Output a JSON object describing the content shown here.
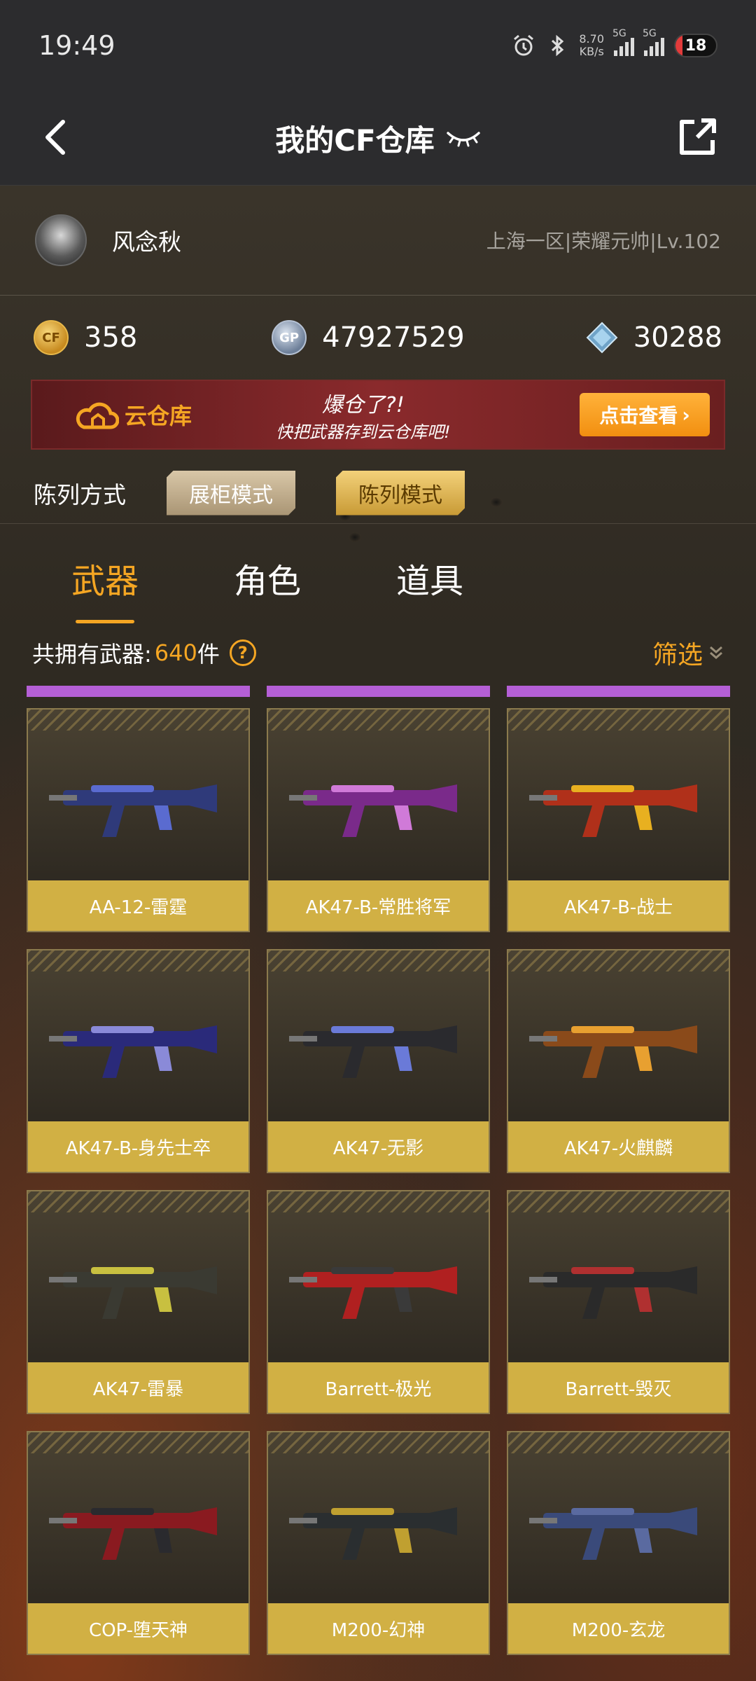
{
  "status_bar": {
    "time": "19:49",
    "net_speed_value": "8.70",
    "net_speed_unit": "KB/s",
    "sim1_label": "5G",
    "sim2_label": "5G",
    "battery": "18",
    "battery_level": 0.18
  },
  "nav": {
    "title": "我的CF仓库"
  },
  "profile": {
    "username": "风念秋",
    "server_info": "上海一区|荣耀元帅|Lv.102"
  },
  "currency": {
    "cf_points": "358",
    "gp": "47927529",
    "diamond": "30288",
    "gp_icon_text": "GP",
    "cf_icon_text": "CF"
  },
  "cloud_banner": {
    "title": "云仓库",
    "message_line1": "爆仓了?!",
    "message_line2": "快把武器存到云仓库吧!",
    "button_label": "点击查看",
    "button_arrow": "›"
  },
  "display_mode": {
    "label": "陈列方式",
    "options": [
      "展柜模式",
      "陈列模式"
    ],
    "selected": "陈列模式"
  },
  "tabs": [
    {
      "label": "武器",
      "active": true
    },
    {
      "label": "角色",
      "active": false
    },
    {
      "label": "道具",
      "active": false
    }
  ],
  "inventory": {
    "count_label": "共拥有武器:",
    "count": "640",
    "count_unit": "件",
    "help_glyph": "?",
    "filter_label": "筛选"
  },
  "items": [
    {
      "name": "AA-12-雷霆",
      "weapon_color": "#2f3a7a",
      "accent": "#5a6bd0"
    },
    {
      "name": "AK47-B-常胜将军",
      "weapon_color": "#7a2a8a",
      "accent": "#d07ad8"
    },
    {
      "name": "AK47-B-战士",
      "weapon_color": "#b0301a",
      "accent": "#e8b020"
    },
    {
      "name": "AK47-B-身先士卒",
      "weapon_color": "#2a2a7a",
      "accent": "#8a8ad8"
    },
    {
      "name": "AK47-无影",
      "weapon_color": "#2a2a2e",
      "accent": "#6a7ad8"
    },
    {
      "name": "AK47-火麒麟",
      "weapon_color": "#8a4a1a",
      "accent": "#e8a030"
    },
    {
      "name": "AK47-雷暴",
      "weapon_color": "#3a3a32",
      "accent": "#c8c040"
    },
    {
      "name": "Barrett-极光",
      "weapon_color": "#b02020",
      "accent": "#3a3a3a"
    },
    {
      "name": "Barrett-毁灭",
      "weapon_color": "#2a2a2a",
      "accent": "#b03030"
    },
    {
      "name": "COP-堕天神",
      "weapon_color": "#8a1a20",
      "accent": "#2a2a2e"
    },
    {
      "name": "M200-幻神",
      "weapon_color": "#2a2e30",
      "accent": "#c0a030"
    },
    {
      "name": "M200-玄龙",
      "weapon_color": "#3a4a7a",
      "accent": "#5a6aa0"
    }
  ],
  "colors": {
    "accent": "#f5a623",
    "rarity_bar": "#b55fd6",
    "item_label_bg": "#d1b044"
  }
}
